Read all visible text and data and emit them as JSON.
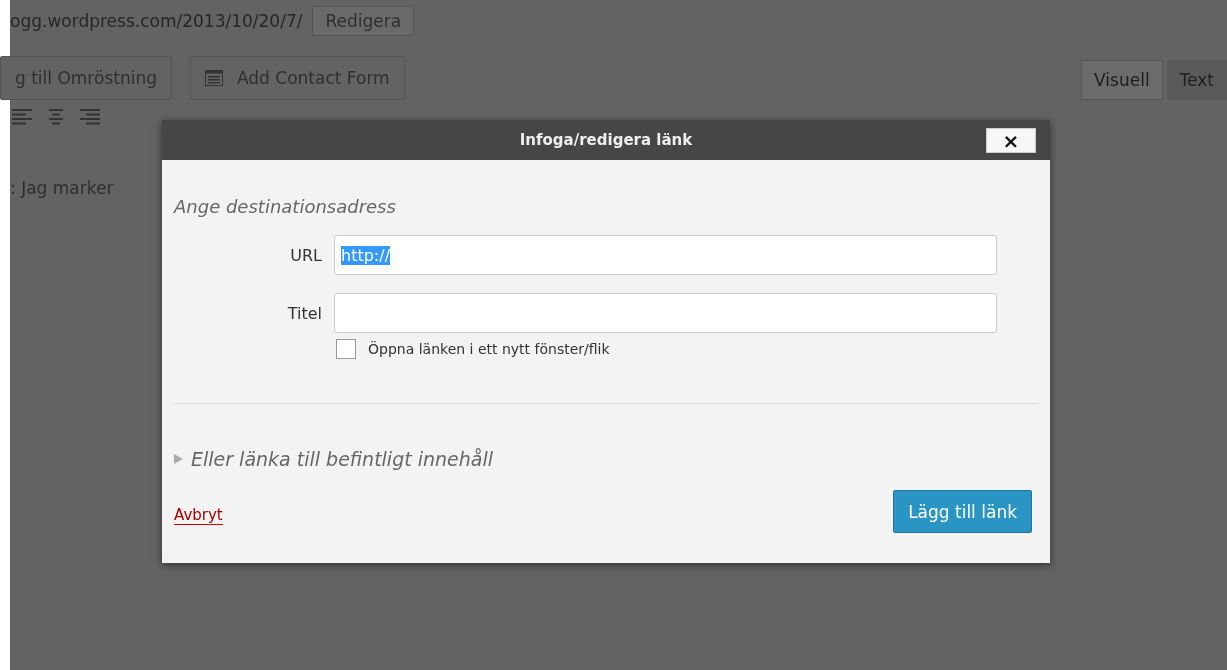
{
  "background": {
    "permalink": "ogg.wordpress.com/2013/10/20/7/",
    "edit_button": "Redigera",
    "media_buttons": [
      {
        "label": "g till Omröstning",
        "kind": "plain"
      },
      {
        "label": "Add Contact Form",
        "kind": "form"
      }
    ],
    "editor_tabs": [
      {
        "label": "Visuell",
        "selected": true
      },
      {
        "label": "Text",
        "selected": false
      }
    ],
    "editor_text": ": Jag marker"
  },
  "dialog": {
    "title": "Infoga/redigera länk",
    "close": "×",
    "section": "Ange destinationsadress",
    "url": {
      "label": "URL",
      "value": "http://",
      "selected": true
    },
    "title_field": {
      "label": "Titel"
    },
    "new_window": {
      "label": "Öppna länken i ett nytt fönster/flik",
      "checked": false
    },
    "existing": {
      "label": "Eller länka till befintligt innehåll",
      "expanded": false
    },
    "cancel": "Avbryt",
    "submit": "Lägg till länk"
  }
}
